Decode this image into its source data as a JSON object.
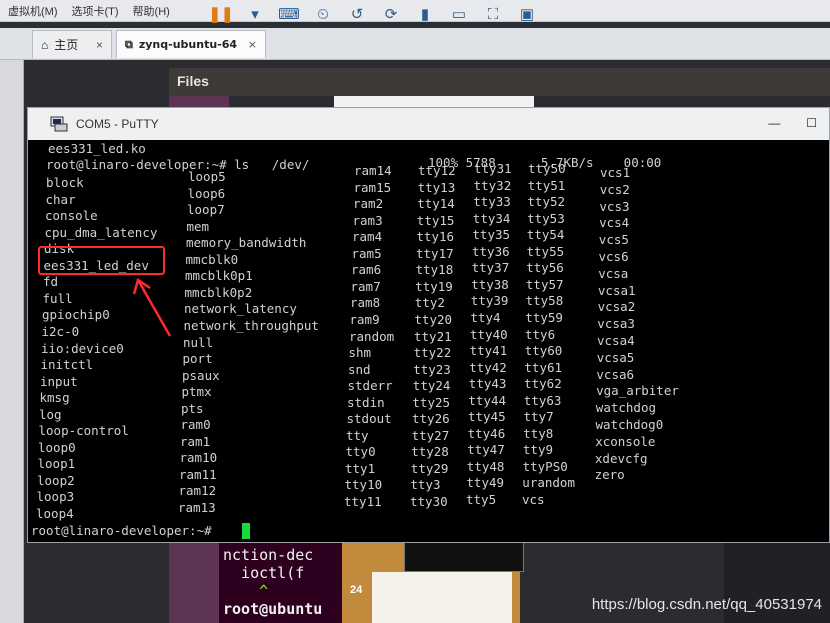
{
  "host": {
    "menu": [
      "虚拟机(M)",
      "选项卡(T)",
      "帮助(H)"
    ],
    "tabs": [
      {
        "label": "主页",
        "close": "×"
      },
      {
        "label": "zynq-ubuntu-64",
        "close": "×"
      }
    ]
  },
  "guest": {
    "files_title": "Files",
    "bg_terminal": {
      "lines": [
        "nction-dec",
        "  ioctl(f",
        "    ^",
        "root@ubuntu"
      ]
    },
    "bg_doc_number": "24"
  },
  "putty": {
    "title": "COM5 - PuTTY",
    "minimize": "—",
    "maximize": "☐"
  },
  "terminal": {
    "line1": "ees331_led.ko",
    "line2": "root@linaro-developer:~# ls   /dev/",
    "transfer": "100% 5788      5.7KB/s    00:00",
    "col1": [
      "block",
      "char",
      "console",
      "cpu_dma_latency",
      "disk",
      "ees331_led_dev",
      "fd",
      "full",
      "gpiochip0",
      "i2c-0",
      "iio:device0",
      "initctl",
      "input",
      "kmsg",
      "log",
      "loop-control",
      "loop0",
      "loop1",
      "loop2",
      "loop3",
      "loop4"
    ],
    "col2": [
      "loop5",
      "loop6",
      "loop7",
      "mem",
      "memory_bandwidth",
      "mmcblk0",
      "mmcblk0p1",
      "mmcblk0p2",
      "network_latency",
      "network_throughput",
      "null",
      "port",
      "psaux",
      "ptmx",
      "pts",
      "ram0",
      "ram1",
      "ram10",
      "ram11",
      "ram12",
      "ram13"
    ],
    "col3": [
      "ram14",
      "ram15",
      "ram2",
      "ram3",
      "ram4",
      "ram5",
      "ram6",
      "ram7",
      "ram8",
      "ram9",
      "random",
      "shm",
      "snd",
      "stderr",
      "stdin",
      "stdout",
      "tty",
      "tty0",
      "tty1",
      "tty10",
      "tty11"
    ],
    "col4": [
      "tty12",
      "tty13",
      "tty14",
      "tty15",
      "tty16",
      "tty17",
      "tty18",
      "tty19",
      "tty2",
      "tty20",
      "tty21",
      "tty22",
      "tty23",
      "tty24",
      "tty25",
      "tty26",
      "tty27",
      "tty28",
      "tty29",
      "tty3",
      "tty30"
    ],
    "col5": [
      "tty31",
      "tty32",
      "tty33",
      "tty34",
      "tty35",
      "tty36",
      "tty37",
      "tty38",
      "tty39",
      "tty4",
      "tty40",
      "tty41",
      "tty42",
      "tty43",
      "tty44",
      "tty45",
      "tty46",
      "tty47",
      "tty48",
      "tty49",
      "tty5"
    ],
    "col6": [
      "tty50",
      "tty51",
      "tty52",
      "tty53",
      "tty54",
      "tty55",
      "tty56",
      "tty57",
      "tty58",
      "tty59",
      "tty6",
      "tty60",
      "tty61",
      "tty62",
      "tty63",
      "tty7",
      "tty8",
      "tty9",
      "ttyPS0",
      "urandom",
      "vcs"
    ],
    "col7": [
      "vcs1",
      "vcs2",
      "vcs3",
      "vcs4",
      "vcs5",
      "vcs6",
      "vcsa",
      "vcsa1",
      "vcsa2",
      "vcsa3",
      "vcsa4",
      "vcsa5",
      "vcsa6",
      "vga_arbiter",
      "watchdog",
      "watchdog0",
      "xconsole",
      "xdevcfg",
      "zero"
    ],
    "prompt": "root@linaro-developer:~# "
  },
  "watermark": "https://blog.csdn.net/qq_40531974",
  "colors": {
    "highlight": "#ff2a2a",
    "cursor": "#19d93a"
  }
}
